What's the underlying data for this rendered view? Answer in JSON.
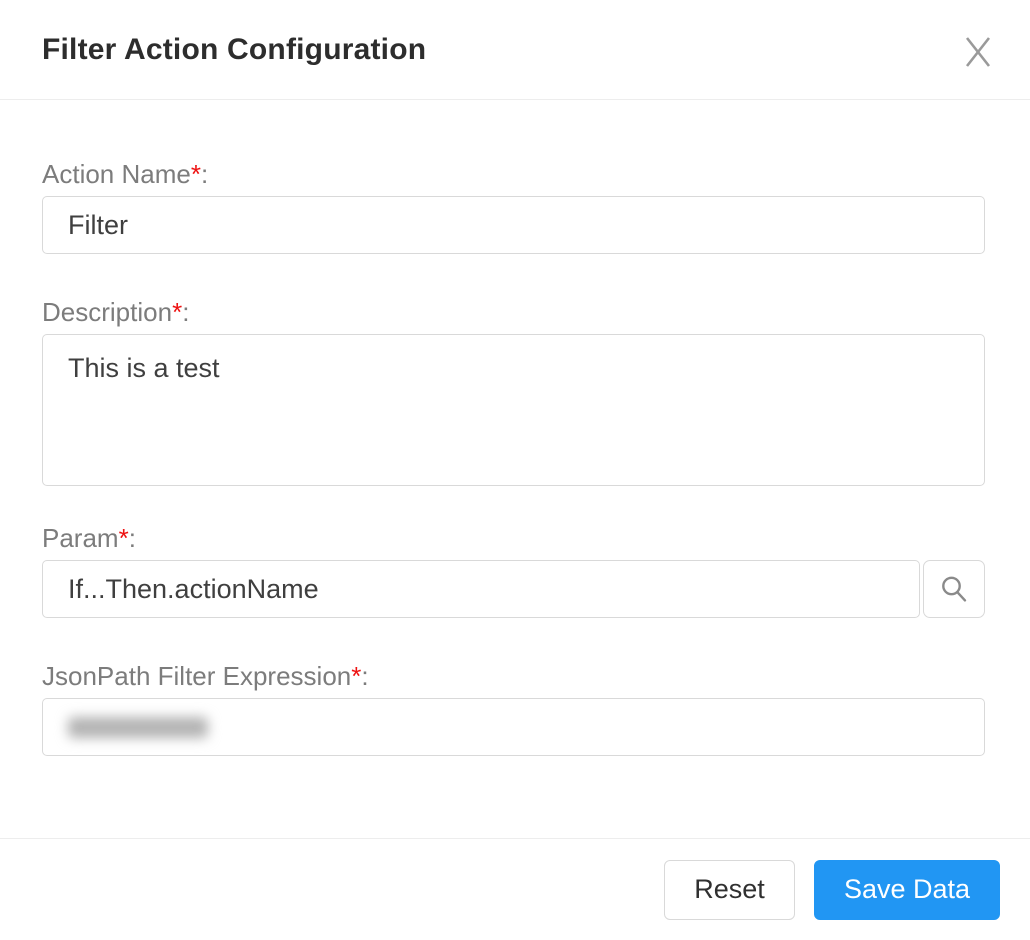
{
  "dialog": {
    "title": "Filter Action Configuration",
    "close_icon": "x-mark"
  },
  "form": {
    "required_mark": "*",
    "colon": ":",
    "action_name": {
      "label": "Action Name",
      "value": "Filter"
    },
    "description": {
      "label": "Description",
      "value": "This is a test"
    },
    "param": {
      "label": "Param",
      "value": "If...Then.actionName",
      "search_icon": "magnifying-glass"
    },
    "jsonpath": {
      "label": "JsonPath Filter Expression",
      "value_state": "redacted-blurred"
    }
  },
  "footer": {
    "reset_label": "Reset",
    "save_label": "Save Data"
  },
  "colors": {
    "primary_blue": "#2196f3",
    "required_red": "#ee1111",
    "label_gray": "#7c7c7c",
    "input_text": "#3f3f3f",
    "input_border": "#d9d9d9",
    "divider": "#ededed",
    "icon_gray": "#9a9a9a",
    "title_text": "#2d2d2d"
  }
}
